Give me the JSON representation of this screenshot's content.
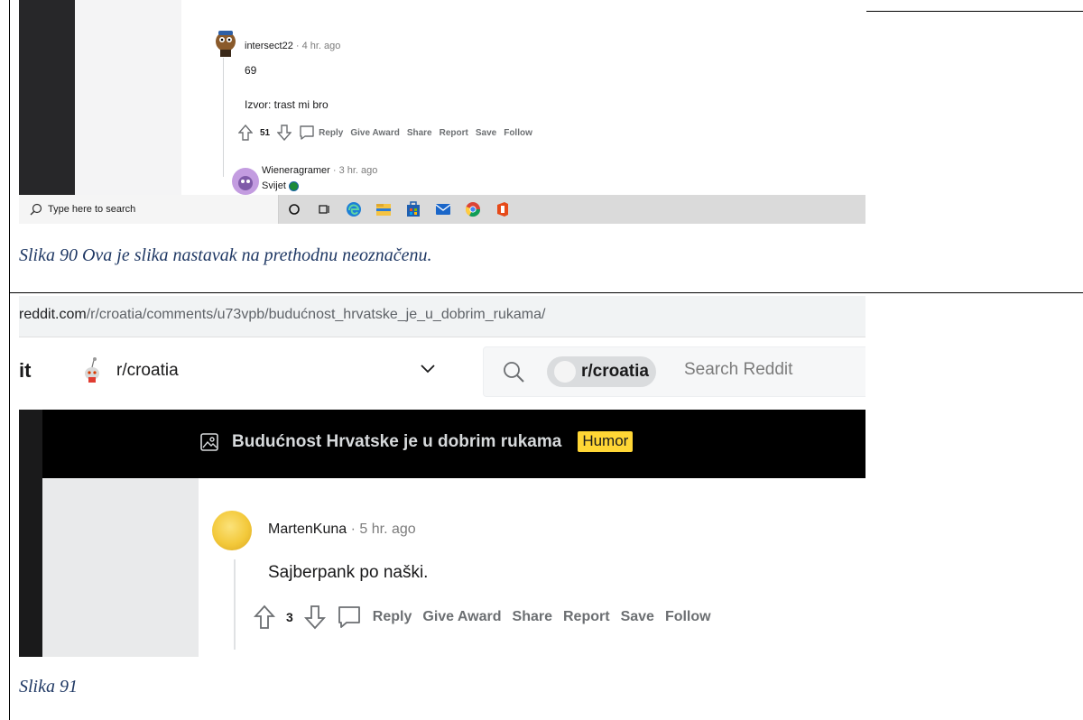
{
  "panel1": {
    "comment1": {
      "username": "intersect22",
      "meta": " · 4 hr. ago",
      "line1": "69",
      "line2": "Izvor: trast mi bro",
      "votes": "51",
      "actions": [
        "Reply",
        "Give Award",
        "Share",
        "Report",
        "Save",
        "Follow"
      ]
    },
    "comment2": {
      "username": "Wieneragramer",
      "meta": " · 3 hr. ago",
      "text": "Svijet"
    },
    "taskbar": {
      "search_placeholder": "Type here to search",
      "icons": [
        "cortana-icon",
        "task-view-icon",
        "edge-icon",
        "file-explorer-icon",
        "store-icon",
        "mail-icon",
        "chrome-icon",
        "office-icon"
      ]
    }
  },
  "caption1": "Slika 90 Ova je slika nastavak na prethodnu neoznačenu.",
  "panel2": {
    "url_domain": "reddit.com",
    "url_path": "/r/croatia/comments/u73vpb/budućnost_hrvatske_je_u_dobrim_rukama/",
    "logo_fragment": "it",
    "subreddit": "r/croatia",
    "search_pill": "r/croatia",
    "search_placeholder": "Search Reddit",
    "post_title": "Budućnost Hrvatske je u dobrim rukama",
    "flair": "Humor",
    "comment": {
      "username": "MartenKuna",
      "meta": " · 5 hr. ago",
      "text": "Sajberpank po naški.",
      "votes": "3",
      "actions": [
        "Reply",
        "Give Award",
        "Share",
        "Report",
        "Save",
        "Follow"
      ]
    }
  },
  "caption2": "Slika 91",
  "colors": {
    "caption": "#1f3864",
    "flair": "#ffd635",
    "post_bar": "#000000"
  }
}
